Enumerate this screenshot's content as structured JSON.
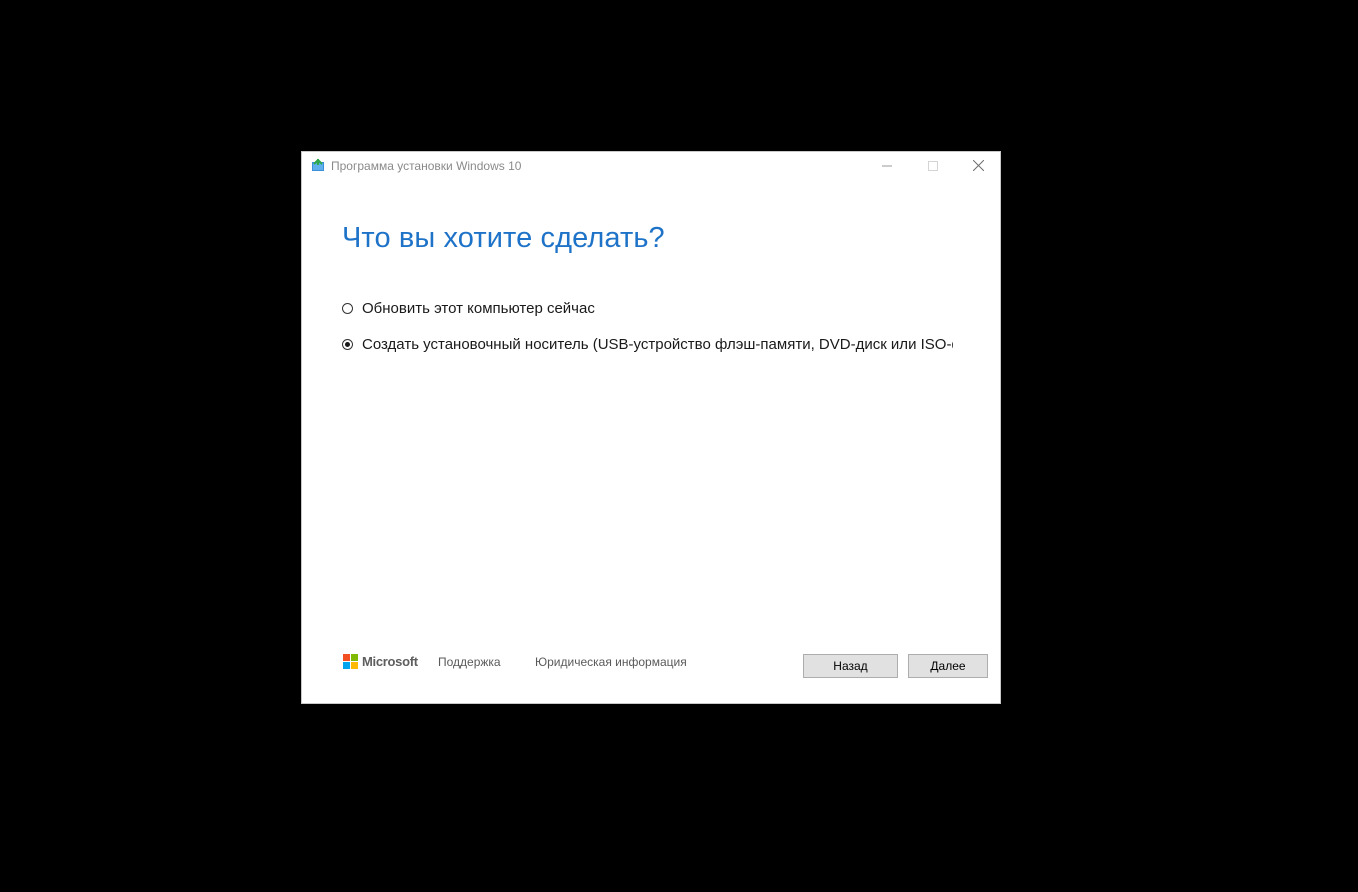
{
  "window": {
    "title": "Программа установки Windows 10",
    "icon": "windows-setup-icon",
    "controls": {
      "minimize_icon": "minimize-icon",
      "maximize_icon": "maximize-icon",
      "close_icon": "close-icon"
    }
  },
  "page": {
    "heading": "Что вы хотите сделать?",
    "options": [
      {
        "label": "Обновить этот компьютер сейчас",
        "selected": false
      },
      {
        "label": "Создать установочный носитель (USB-устройство флэш-памяти, DVD-диск или ISO-файл) для другого компьютера",
        "selected": true
      }
    ]
  },
  "footer": {
    "brand": "Microsoft",
    "links": [
      "Поддержка",
      "Юридическая информация"
    ],
    "buttons": {
      "back": "Назад",
      "next": "Далее"
    }
  },
  "colors": {
    "accent": "#1e73c8",
    "ms_red": "#f25022",
    "ms_green": "#7fba00",
    "ms_blue": "#00a4ef",
    "ms_yellow": "#ffb900"
  }
}
